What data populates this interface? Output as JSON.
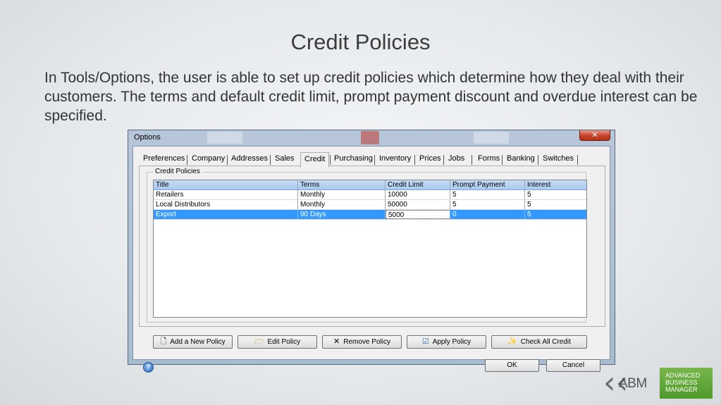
{
  "slide": {
    "title": "Credit Policies",
    "body": "In Tools/Options, the user is able to set up credit policies which determine how they deal with their customers. The terms and default credit limit, prompt payment discount and overdue interest can be specified."
  },
  "dialog": {
    "title": "Options",
    "close_glyph": "✕",
    "tabs": [
      {
        "label": "Preferences"
      },
      {
        "label": "Company"
      },
      {
        "label": "Addresses"
      },
      {
        "label": "Sales"
      },
      {
        "label": "Credit",
        "active": true
      },
      {
        "label": "Purchasing"
      },
      {
        "label": "Inventory"
      },
      {
        "label": "Prices"
      },
      {
        "label": "Jobs"
      },
      {
        "label": "Forms"
      },
      {
        "label": "Banking"
      },
      {
        "label": "Switches"
      }
    ],
    "group_label": "Credit Policies",
    "grid": {
      "columns": [
        "Title",
        "Terms",
        "Credit Limit",
        "Prompt Payment",
        "Interest"
      ],
      "rows": [
        {
          "title": "Retailers",
          "terms": "Monthly",
          "credit_limit": "10000",
          "prompt_payment": "5",
          "interest": "5",
          "selected": false
        },
        {
          "title": "Local Distributors",
          "terms": "Monthly",
          "credit_limit": "50000",
          "prompt_payment": "5",
          "interest": "5",
          "selected": false
        },
        {
          "title": "Export",
          "terms": "90 Days",
          "credit_limit": "5000",
          "prompt_payment": "0",
          "interest": "5",
          "selected": true
        }
      ]
    },
    "buttons": {
      "add": "Add a New Policy",
      "edit": "Edit Policy",
      "remove": "Remove Policy",
      "apply": "Apply Policy",
      "check": "Check All Credit",
      "ok": "OK",
      "cancel": "Cancel"
    },
    "icons": {
      "add": "new-document-icon",
      "edit": "open-folder-icon",
      "remove": "x-icon",
      "apply": "checklist-icon",
      "check": "sparkle-folder-icon",
      "help": "help-icon"
    }
  },
  "logo": {
    "abm": "ABM",
    "line1": "ADVANCED",
    "line2": "BUSINESS",
    "line3": "MANAGER"
  },
  "colors": {
    "selection": "#3399ff",
    "logo_green": "#5fa83a"
  }
}
